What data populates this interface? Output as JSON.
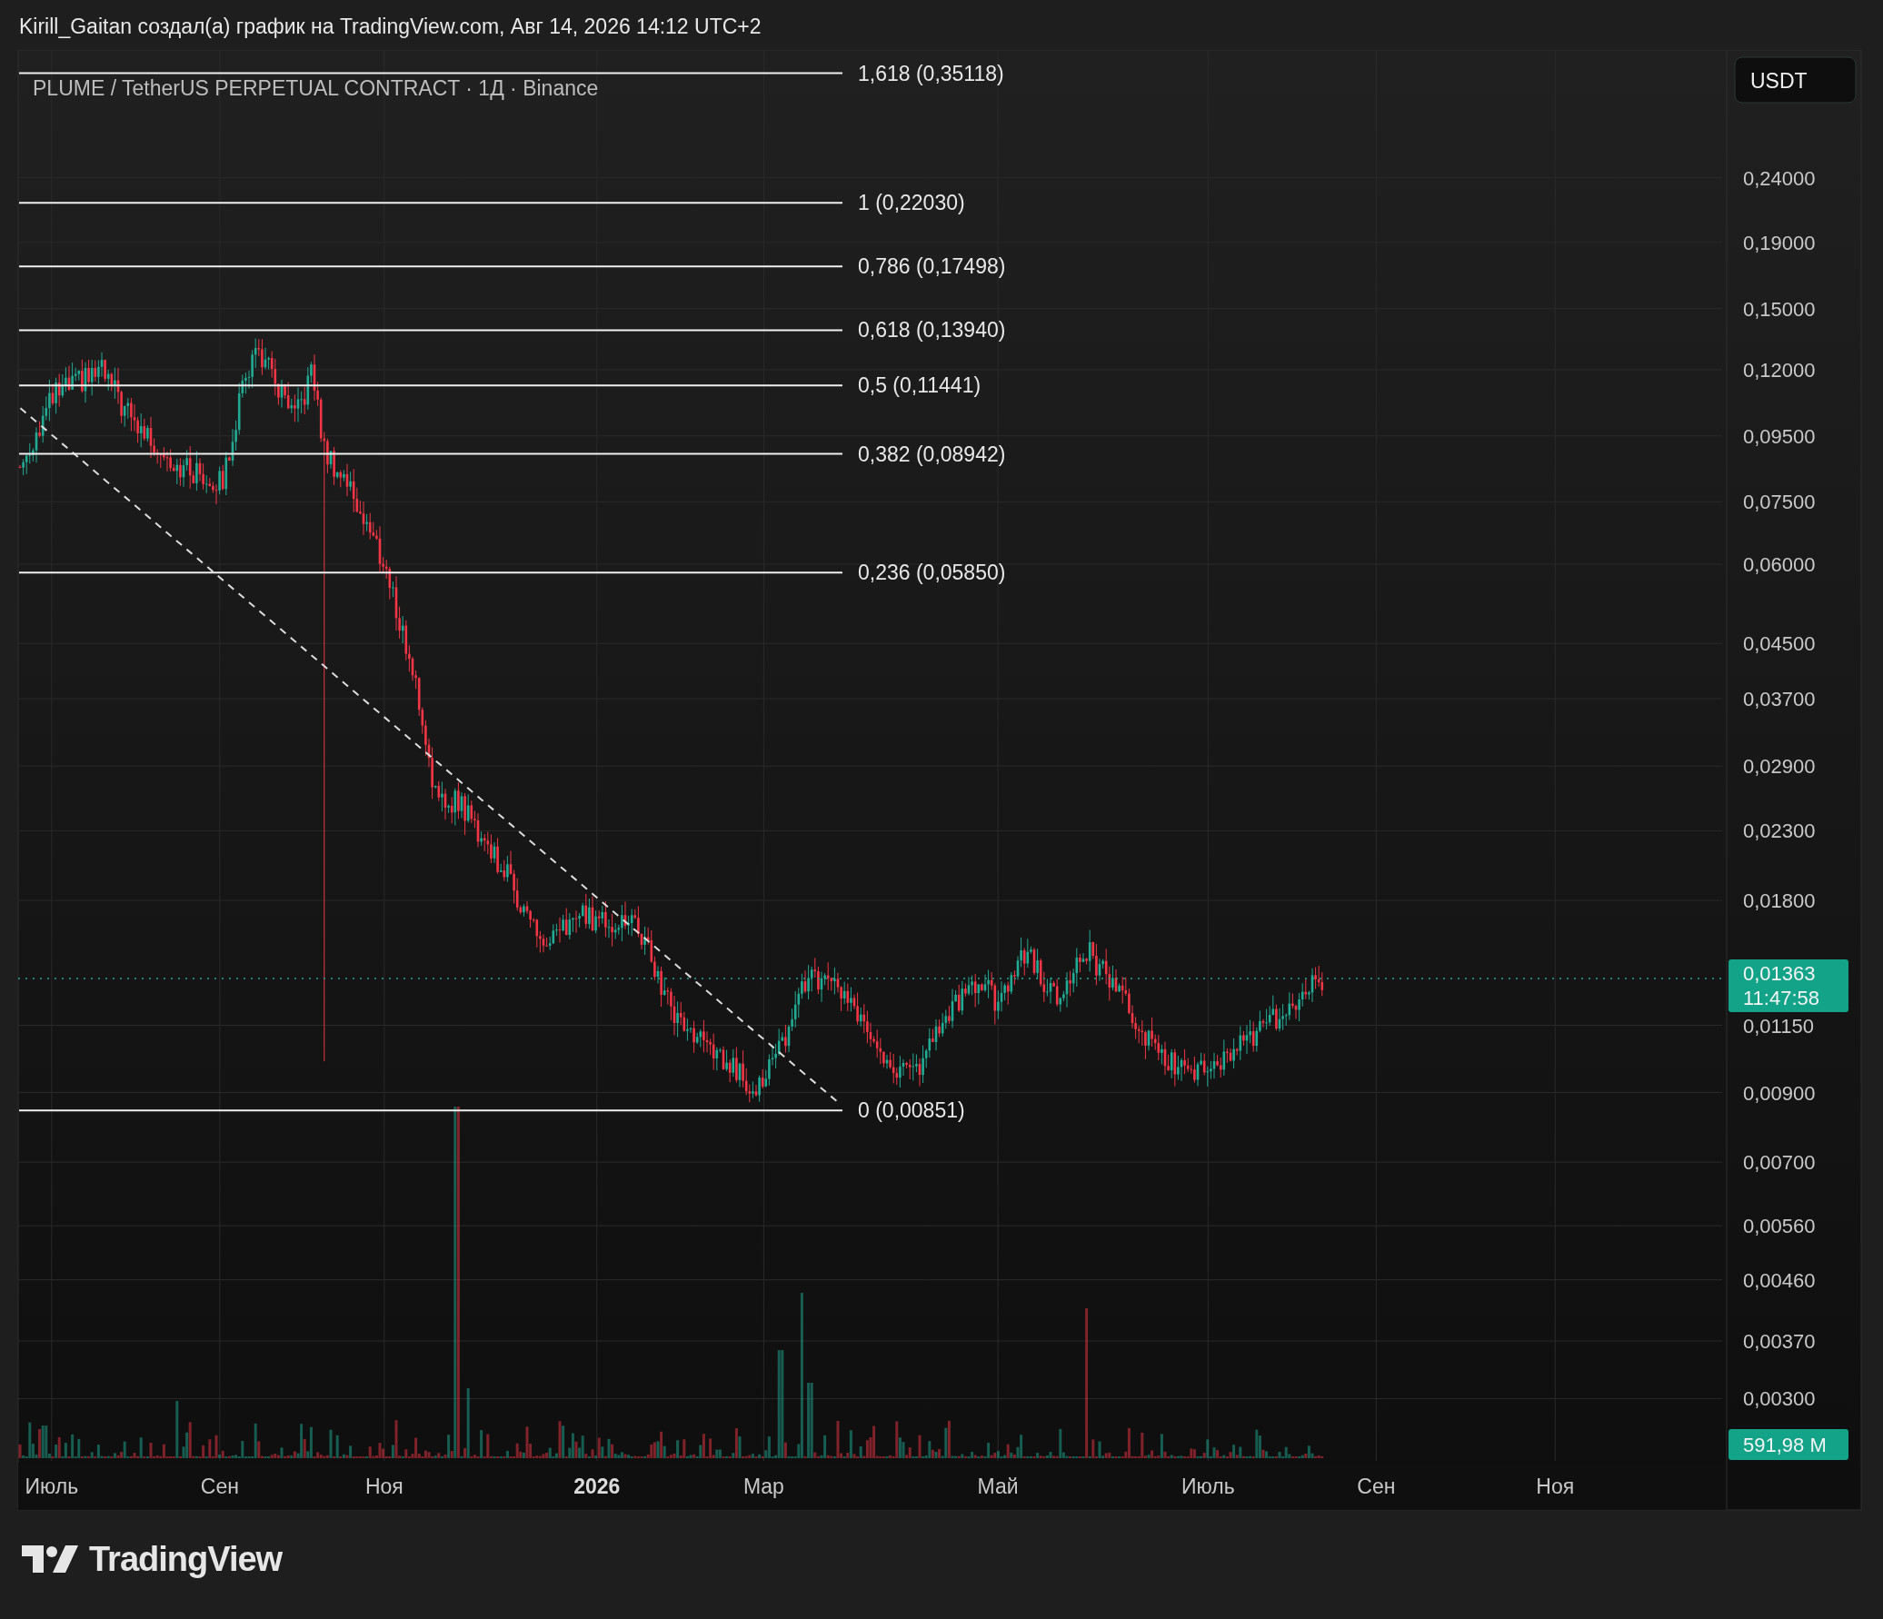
{
  "header": {
    "title": "Kirill_Gaitan создал(а) график на TradingView.com, Авг 14, 2026 14:12 UTC+2"
  },
  "chart": {
    "symbol": "PLUME / TetherUS PERPETUAL CONTRACT · 1Д · Binance",
    "currency_button": "USDT",
    "fib_levels": [
      {
        "label": "1,618 (0,35118)"
      },
      {
        "label": "1 (0,22030)"
      },
      {
        "label": "0,786 (0,17498)"
      },
      {
        "label": "0,618 (0,13940)"
      },
      {
        "label": "0,5 (0,11441)"
      },
      {
        "label": "0,382 (0,08942)"
      },
      {
        "label": "0,236 (0,05850)"
      },
      {
        "label": "0 (0,00851)"
      }
    ],
    "price_ticks": [
      "0,24000",
      "0,19000",
      "0,15000",
      "0,12000",
      "0,09500",
      "0,07500",
      "0,06000",
      "0,04500",
      "0,03700",
      "0,02900",
      "0,02300",
      "0,01800",
      "0,01150",
      "0,00900",
      "0,00700",
      "0,00560",
      "0,00460",
      "0,00370",
      "0,00300"
    ],
    "last_price": {
      "price": "0,01363",
      "countdown": "11:47:58"
    },
    "volume_tag": "591,98 M",
    "time_labels": [
      {
        "text": "Июль",
        "kind": "month"
      },
      {
        "text": "Сен",
        "kind": "month"
      },
      {
        "text": "Ноя",
        "kind": "month"
      },
      {
        "text": "2026",
        "kind": "year"
      },
      {
        "text": "Мар",
        "kind": "month"
      },
      {
        "text": "Май",
        "kind": "month"
      },
      {
        "text": "Июль",
        "kind": "month"
      },
      {
        "text": "Сен",
        "kind": "month"
      },
      {
        "text": "Ноя",
        "kind": "month"
      }
    ]
  },
  "footer": {
    "logo": "TradingView"
  }
}
